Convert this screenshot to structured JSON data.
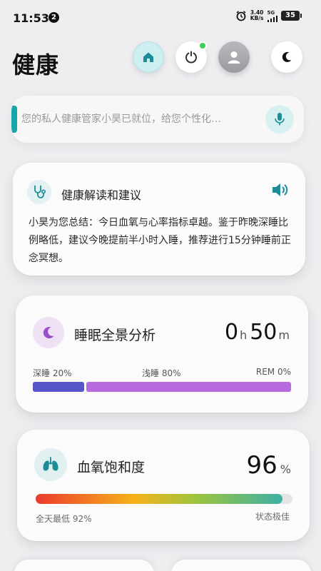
{
  "status_bar": {
    "time": "11:53",
    "notification_count": "2",
    "speed_value": "3.40",
    "speed_unit": "KB/s",
    "network": "5G",
    "battery": "35"
  },
  "header": {
    "title": "健康"
  },
  "search": {
    "placeholder": "您的私人健康管家小昊已就位，给您个性化…"
  },
  "advice_card": {
    "title": "健康解读和建议",
    "text": "小昊为您总结：今日血氧与心率指标卓越。鉴于昨晚深睡比例略低，建议今晚提前半小时入睡，推荐进行15分钟睡前正念冥想。"
  },
  "sleep_card": {
    "title": "睡眠全景分析",
    "hours": "0",
    "hours_unit": "h",
    "minutes": "50",
    "minutes_unit": "m",
    "deep_label": "深睡 20%",
    "light_label": "浅睡 80%",
    "rem_label": "REM 0%",
    "deep_pct": 20,
    "light_pct": 80,
    "rem_pct": 0
  },
  "spo2_card": {
    "title": "血氧饱和度",
    "value": "96",
    "unit": "%",
    "level_pct": 96,
    "min_label": "全天最低 92%",
    "status_label": "状态极佳"
  },
  "colors": {
    "accent": "#14a6a8",
    "deep_sleep": "#5656c9",
    "light_sleep": "#b76ae0",
    "online_dot": "#3fcf5a"
  },
  "icons": {
    "home": "home-icon",
    "timer": "power-timer-icon",
    "profile": "user-icon",
    "theme": "moon-icon",
    "mic": "microphone-icon",
    "advice": "stethoscope-icon",
    "speaker": "speaker-icon",
    "sleep": "moon-icon",
    "spo2": "lungs-icon"
  }
}
